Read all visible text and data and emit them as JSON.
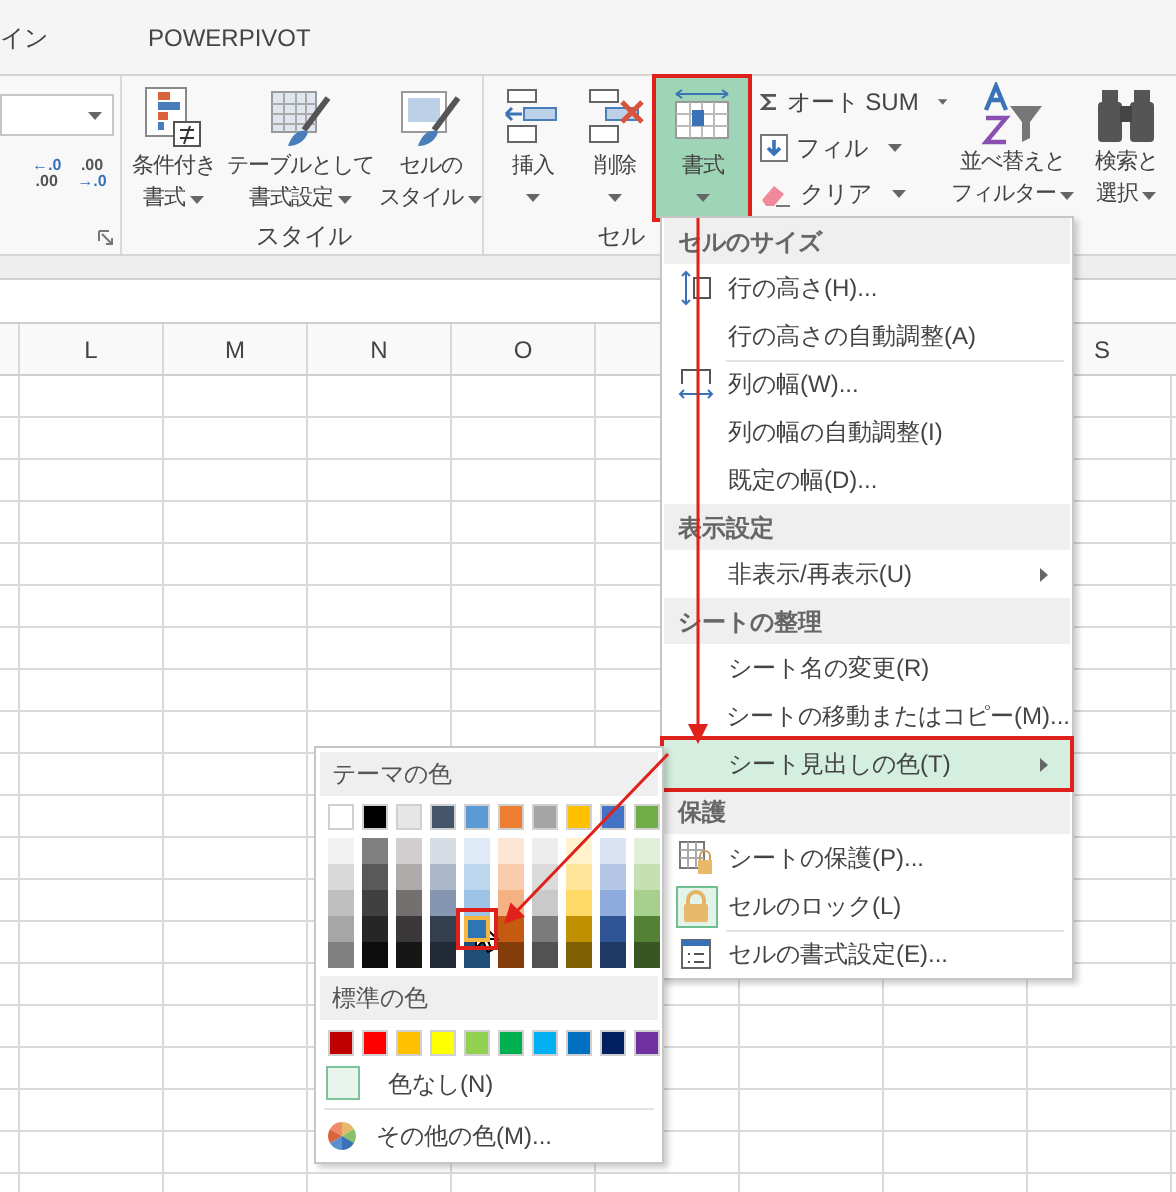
{
  "tabs": [
    {
      "label": "イン",
      "selected": false
    },
    {
      "label": "POWERPIVOT",
      "selected": false
    }
  ],
  "ribbon": {
    "decimal_buttons": [
      [
        {
          "text": "←.0",
          "accent": true
        },
        {
          "text": ".00",
          "accent": false
        }
      ],
      [
        {
          "text": ".00",
          "accent": false
        },
        {
          "text": "→.0",
          "accent": true
        }
      ]
    ],
    "groups": [
      {
        "label": "スタイル",
        "buttons": [
          {
            "lines": [
              "条件付き",
              "書式"
            ],
            "dropdown": true,
            "marked": false
          },
          {
            "lines": [
              "テーブルとして",
              "書式設定"
            ],
            "dropdown": true,
            "marked": false
          },
          {
            "lines": [
              "セルの",
              "スタイル"
            ],
            "dropdown": true,
            "marked": false
          }
        ]
      },
      {
        "label": "セル",
        "buttons": [
          {
            "lines": [
              "挿入"
            ],
            "dropdown": true,
            "marked": false
          },
          {
            "lines": [
              "削除"
            ],
            "dropdown": true,
            "marked": false
          },
          {
            "lines": [
              "書式"
            ],
            "dropdown": true,
            "marked": true
          }
        ]
      }
    ],
    "edit_small_buttons": [
      {
        "label": "オート SUM",
        "dropdown": true
      },
      {
        "label": "フィル",
        "dropdown": true
      },
      {
        "label": "クリア",
        "dropdown": true
      }
    ],
    "edit_big_buttons": [
      {
        "lines": [
          "並べ替えと",
          "フィルター"
        ],
        "dropdown": true
      },
      {
        "lines": [
          "検索と",
          "選択"
        ],
        "dropdown": true
      }
    ]
  },
  "columns": [
    "L",
    "M",
    "N",
    "O",
    "S"
  ],
  "menu": {
    "sections": [
      {
        "header": "セルのサイズ",
        "items": [
          {
            "label": "行の高さ(H)...",
            "separator_before": false,
            "submenu": false,
            "selected": false,
            "checked": false,
            "marked": false
          },
          {
            "label": "行の高さの自動調整(A)",
            "separator_before": false,
            "submenu": false,
            "selected": false,
            "checked": false,
            "marked": false
          },
          {
            "label": "列の幅(W)...",
            "separator_before": true,
            "submenu": false,
            "selected": false,
            "checked": false,
            "marked": false
          },
          {
            "label": "列の幅の自動調整(I)",
            "separator_before": false,
            "submenu": false,
            "selected": false,
            "checked": false,
            "marked": false
          },
          {
            "label": "既定の幅(D)...",
            "separator_before": false,
            "submenu": false,
            "selected": false,
            "checked": false,
            "marked": false
          }
        ]
      },
      {
        "header": "表示設定",
        "items": [
          {
            "label": "非表示/再表示(U)",
            "separator_before": false,
            "submenu": true,
            "selected": false,
            "checked": false,
            "marked": false
          }
        ]
      },
      {
        "header": "シートの整理",
        "items": [
          {
            "label": "シート名の変更(R)",
            "separator_before": false,
            "submenu": false,
            "selected": false,
            "checked": false,
            "marked": false
          },
          {
            "label": "シートの移動またはコピー(M)...",
            "separator_before": false,
            "submenu": false,
            "selected": false,
            "checked": false,
            "marked": false
          },
          {
            "label": "シート見出しの色(T)",
            "separator_before": false,
            "submenu": true,
            "selected": true,
            "checked": false,
            "marked": true
          }
        ]
      },
      {
        "header": "保護",
        "items": [
          {
            "label": "シートの保護(P)...",
            "separator_before": false,
            "submenu": false,
            "selected": false,
            "checked": false,
            "marked": false
          },
          {
            "label": "セルのロック(L)",
            "separator_before": false,
            "submenu": false,
            "selected": false,
            "checked": true,
            "marked": false
          },
          {
            "label": "セルの書式設定(E)...",
            "separator_before": true,
            "submenu": false,
            "selected": false,
            "checked": false,
            "marked": false
          }
        ]
      }
    ]
  },
  "palette": {
    "theme_header": "テーマの色",
    "theme_columns": [
      {
        "color": "#ffffff",
        "selected": false,
        "shades": [
          {
            "color": "#f2f2f2",
            "selected": false
          },
          {
            "color": "#d9d9d9",
            "selected": false
          },
          {
            "color": "#bfbfbf",
            "selected": false
          },
          {
            "color": "#a6a6a6",
            "selected": false
          },
          {
            "color": "#808080",
            "selected": false
          }
        ]
      },
      {
        "color": "#000000",
        "selected": false,
        "shades": [
          {
            "color": "#808080",
            "selected": false
          },
          {
            "color": "#595959",
            "selected": false
          },
          {
            "color": "#404040",
            "selected": false
          },
          {
            "color": "#262626",
            "selected": false
          },
          {
            "color": "#0d0d0d",
            "selected": false
          }
        ]
      },
      {
        "color": "#e7e6e6",
        "selected": false,
        "shades": [
          {
            "color": "#d0cece",
            "selected": false
          },
          {
            "color": "#aeabab",
            "selected": false
          },
          {
            "color": "#757070",
            "selected": false
          },
          {
            "color": "#3a3838",
            "selected": false
          },
          {
            "color": "#171616",
            "selected": false
          }
        ]
      },
      {
        "color": "#44546a",
        "selected": false,
        "shades": [
          {
            "color": "#d6dce4",
            "selected": false
          },
          {
            "color": "#acb9ca",
            "selected": false
          },
          {
            "color": "#8496b0",
            "selected": false
          },
          {
            "color": "#333f4f",
            "selected": false
          },
          {
            "color": "#222a35",
            "selected": false
          }
        ]
      },
      {
        "color": "#5b9bd5",
        "selected": false,
        "shades": [
          {
            "color": "#deebf6",
            "selected": false
          },
          {
            "color": "#bdd7ee",
            "selected": false
          },
          {
            "color": "#9dc3e6",
            "selected": false
          },
          {
            "color": "#2e75b5",
            "selected": true
          },
          {
            "color": "#1f4e79",
            "selected": false
          }
        ]
      },
      {
        "color": "#ed7d31",
        "selected": false,
        "shades": [
          {
            "color": "#fbe5d5",
            "selected": false
          },
          {
            "color": "#f7cbac",
            "selected": false
          },
          {
            "color": "#f4b183",
            "selected": false
          },
          {
            "color": "#c55a11",
            "selected": false
          },
          {
            "color": "#843c0b",
            "selected": false
          }
        ]
      },
      {
        "color": "#a5a5a5",
        "selected": false,
        "shades": [
          {
            "color": "#ededed",
            "selected": false
          },
          {
            "color": "#dbdbdb",
            "selected": false
          },
          {
            "color": "#c9c9c9",
            "selected": false
          },
          {
            "color": "#7b7b7b",
            "selected": false
          },
          {
            "color": "#525252",
            "selected": false
          }
        ]
      },
      {
        "color": "#ffc000",
        "selected": false,
        "shades": [
          {
            "color": "#fff2cc",
            "selected": false
          },
          {
            "color": "#fee599",
            "selected": false
          },
          {
            "color": "#ffd965",
            "selected": false
          },
          {
            "color": "#bf9000",
            "selected": false
          },
          {
            "color": "#7f6000",
            "selected": false
          }
        ]
      },
      {
        "color": "#4472c4",
        "selected": false,
        "shades": [
          {
            "color": "#dae3f3",
            "selected": false
          },
          {
            "color": "#b4c7e7",
            "selected": false
          },
          {
            "color": "#8faadc",
            "selected": false
          },
          {
            "color": "#2f5597",
            "selected": false
          },
          {
            "color": "#203864",
            "selected": false
          }
        ]
      },
      {
        "color": "#70ad47",
        "selected": false,
        "shades": [
          {
            "color": "#e2efd9",
            "selected": false
          },
          {
            "color": "#c5e0b3",
            "selected": false
          },
          {
            "color": "#a8d08d",
            "selected": false
          },
          {
            "color": "#538135",
            "selected": false
          },
          {
            "color": "#375623",
            "selected": false
          }
        ]
      }
    ],
    "standard_header": "標準の色",
    "standard_colors": [
      {
        "color": "#c00000",
        "selected": false
      },
      {
        "color": "#ff0000",
        "selected": false
      },
      {
        "color": "#ffc000",
        "selected": false
      },
      {
        "color": "#ffff00",
        "selected": false
      },
      {
        "color": "#92d050",
        "selected": false
      },
      {
        "color": "#00b050",
        "selected": false
      },
      {
        "color": "#00b0f0",
        "selected": false
      },
      {
        "color": "#0070c0",
        "selected": false
      },
      {
        "color": "#002060",
        "selected": false
      },
      {
        "color": "#7030a0",
        "selected": false
      }
    ],
    "no_color": "色なし(N)",
    "more_colors": "その他の色(M)..."
  }
}
